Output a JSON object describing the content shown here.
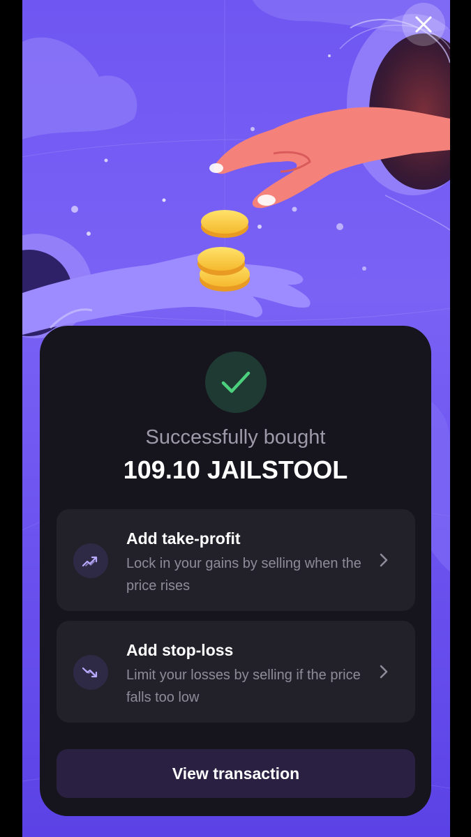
{
  "header": {
    "close_icon": "close-icon"
  },
  "result": {
    "status_icon": "checkmark-icon",
    "status_color": "#4cd07d",
    "subtitle": "Successfully bought",
    "amount": "109.10 JAILSTOOL"
  },
  "options": [
    {
      "icon": "trend-up-icon",
      "title": "Add take-profit",
      "description": "Lock in your gains by selling when the price rises"
    },
    {
      "icon": "trend-down-icon",
      "title": "Add stop-loss",
      "description": "Limit your losses by selling if the price falls too low"
    }
  ],
  "footer": {
    "view_transaction_label": "View transaction"
  },
  "colors": {
    "background": "#6f56f2",
    "sheet": "#16141d",
    "card": "#222029",
    "accent_icon": "#b9a9ff",
    "button": "#2a2142"
  }
}
